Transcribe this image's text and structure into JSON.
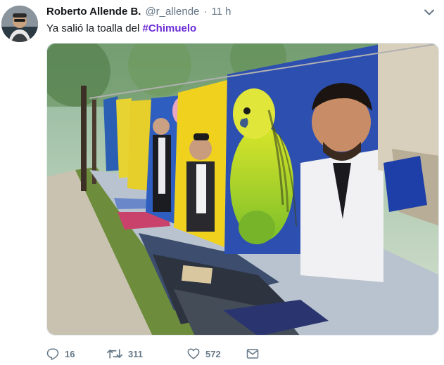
{
  "author": {
    "display_name": "Roberto Allende B.",
    "handle": "@r_allende",
    "separator": "·",
    "time": "11 h"
  },
  "tweet": {
    "text_prefix": "Ya salió la toalla del ",
    "hashtag": "#Chimuelo"
  },
  "media": {
    "description_icon": "photo-icon",
    "parakeet_color": "#c7de1f"
  },
  "actions": {
    "replies": "16",
    "retweets": "311",
    "likes": "572"
  },
  "icons": {
    "reply": "reply-icon",
    "retweet": "retweet-icon",
    "like": "heart-icon",
    "share": "envelope-icon",
    "menu": "chevron-down-icon"
  },
  "colors": {
    "hashtag": "#6b2bd6",
    "muted": "#657786"
  }
}
